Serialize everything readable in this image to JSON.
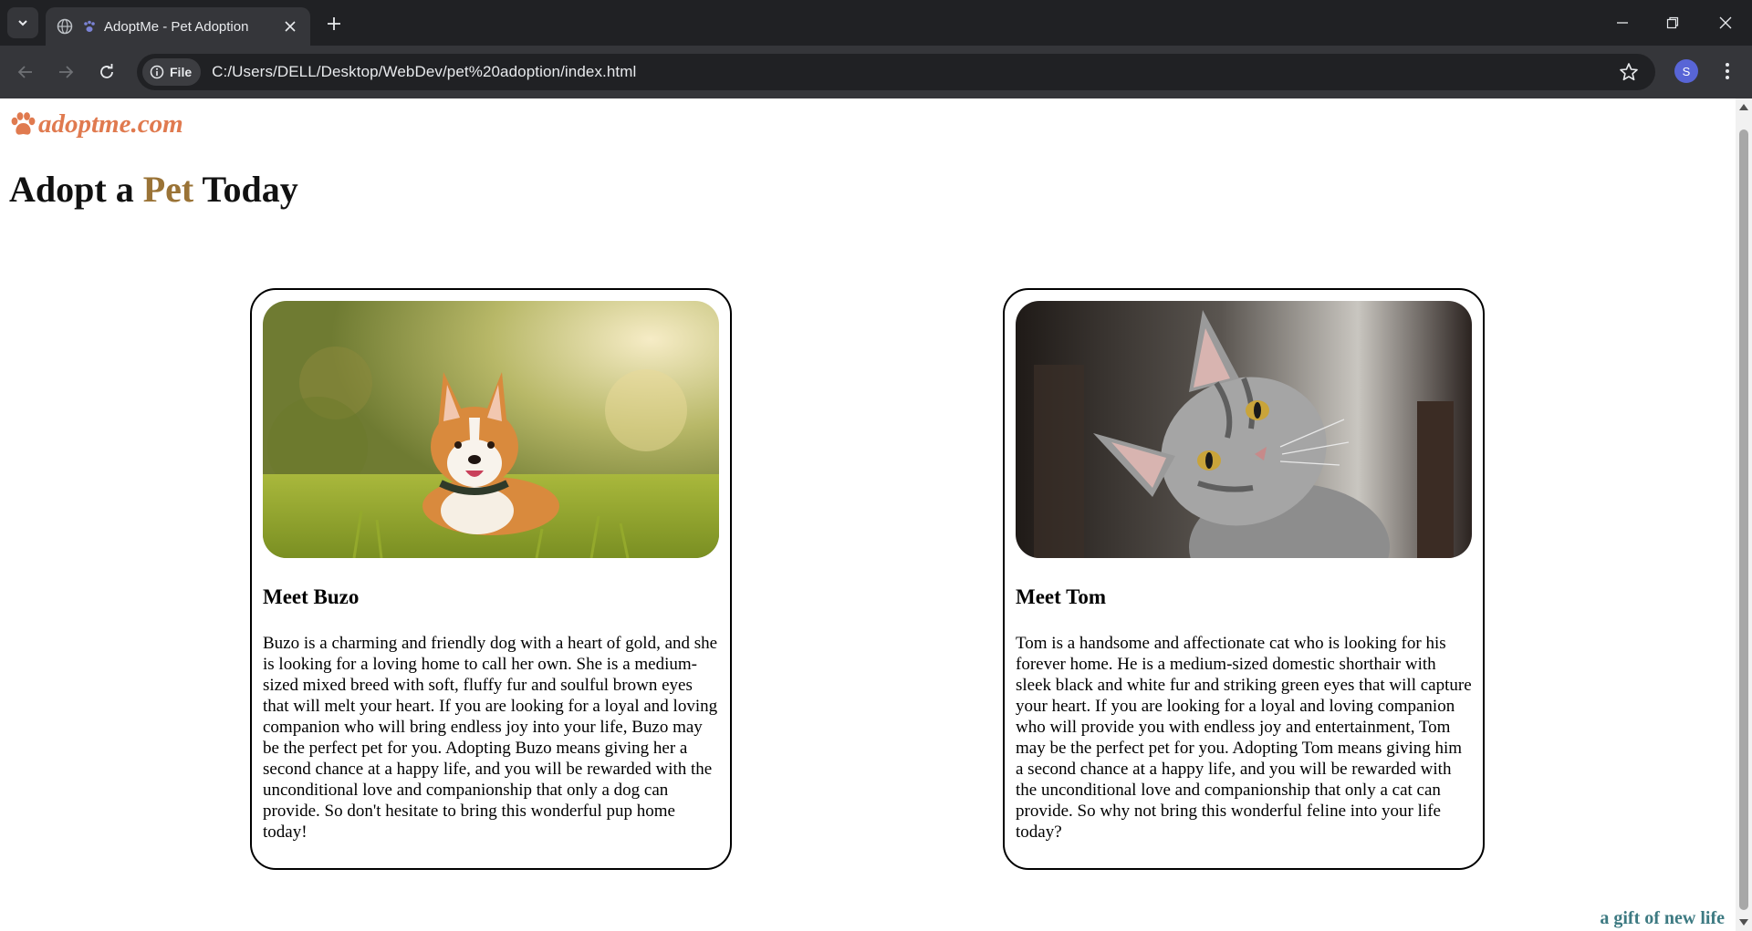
{
  "browser": {
    "tab_title": "AdoptMe - Pet Adoption",
    "omnibox_chip": "File",
    "url": "C:/Users/DELL/Desktop/WebDev/pet%20adoption/index.html",
    "profile_initial": "S",
    "icons": [
      "tab-search-icon",
      "globe-icon",
      "paw-icon",
      "close-icon",
      "plus-icon",
      "minimize-icon",
      "restore-icon",
      "close-window-icon",
      "back-icon",
      "forward-icon",
      "reload-icon",
      "info-icon",
      "star-icon",
      "kebab-menu-icon"
    ]
  },
  "page": {
    "logo_text": "adoptme.com",
    "heading": {
      "before": "Adopt a ",
      "accent": "Pet",
      "after": " Today"
    },
    "pets": [
      {
        "title": "Meet Buzo",
        "image": "corgi-dog-photo",
        "description": "Buzo is a charming and friendly dog with a heart of gold, and she is looking for a loving home to call her own. She is a medium-sized mixed breed with soft, fluffy fur and soulful brown eyes that will melt your heart. If you are looking for a loyal and loving companion who will bring endless joy into your life, Buzo may be the perfect pet for you. Adopting Buzo means giving her a second chance at a happy life, and you will be rewarded with the unconditional love and companionship that only a dog can provide. So don't hesitate to bring this wonderful pup home today!"
      },
      {
        "title": "Meet Tom",
        "image": "grey-cat-photo",
        "description": "Tom is a handsome and affectionate cat who is looking for his forever home. He is a medium-sized domestic shorthair with sleek black and white fur and striking green eyes that will capture your heart. If you are looking for a loyal and loving companion who will provide you with endless joy and entertainment, Tom may be the perfect pet for you. Adopting Tom means giving him a second chance at a happy life, and you will be rewarded with the unconditional love and companionship that only a cat can provide. So why not bring this wonderful feline into your life today?"
      }
    ],
    "tagline": "a gift of new life"
  },
  "colors": {
    "logo": "#e07a4f",
    "accent": "#9a7336",
    "tagline": "#3d7a82",
    "chrome_dark": "#202124",
    "chrome_mid": "#35363a"
  }
}
